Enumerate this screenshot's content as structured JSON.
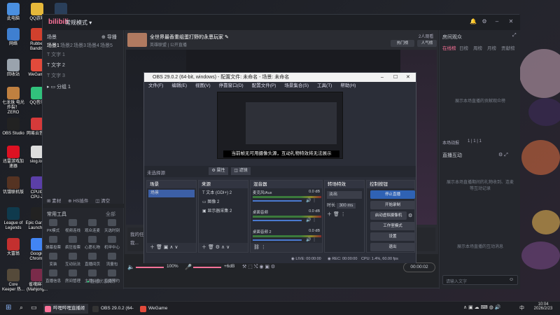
{
  "desktop": {
    "icons": [
      {
        "label": "此电脑",
        "color": "#4a8fe0"
      },
      {
        "label": "QQ游戏",
        "color": "#e6b83a"
      },
      {
        "label": "Steam",
        "color": "#2a3f5a"
      },
      {
        "label": "网络",
        "color": "#3f7fd0"
      },
      {
        "label": "Rubber Bandits",
        "color": "#d2402d"
      },
      {
        "label": "回收站",
        "color": "#9aa3ad"
      },
      {
        "label": "WeGame",
        "color": "#e24a3b"
      },
      {
        "label": "七龙珠 电光炸裂！ZERO",
        "color": "#c08040"
      },
      {
        "label": "QQ音乐",
        "color": "#31c27c"
      },
      {
        "label": "OBS Studio",
        "color": "#222"
      },
      {
        "label": "网易云音乐",
        "color": "#d63a3a"
      },
      {
        "label": "迅雷游戏加速器",
        "color": "#d12"
      },
      {
        "label": "slog.log",
        "color": "#ddd"
      },
      {
        "label": "饥饿联机版",
        "color": "#553322"
      },
      {
        "label": "CPUID CPU-Z",
        "color": "#5b3fa8"
      },
      {
        "label": "League of Legends",
        "color": "#0f3a4d"
      },
      {
        "label": "Epic Games Launcher",
        "color": "#222"
      },
      {
        "label": "大富翁",
        "color": "#c3302f"
      },
      {
        "label": "Google Chrome",
        "color": "#4285f4"
      },
      {
        "label": "Core Keeper 热...",
        "color": "#554a3a"
      },
      {
        "label": "雀魂麻将(Mahjong...",
        "color": "#7a2b4a"
      }
    ]
  },
  "livehime": {
    "logo": "bilibili",
    "mode": "常规模式",
    "scenes": {
      "title": "场景",
      "import": "导播",
      "tabs": [
        "场景1",
        "场景2",
        "场景3",
        "场景4",
        "场景5"
      ],
      "items": [
        "文字 1",
        "文字 2",
        "文字 3"
      ],
      "group": "分组 1",
      "bottom": [
        "素材",
        "HS插件",
        "清空"
      ]
    },
    "tools": {
      "title": "常用工具",
      "more": "全部",
      "items": [
        "PK模式",
        "视频连线",
        "观众连麦",
        "天选时刻",
        "弹幕投票",
        "疯狂投票",
        "心愿礼物",
        "机甲中心",
        "变装",
        "互动玩法",
        "直播间页",
        "流量包",
        "直播信息",
        "房间管理",
        "主播公告",
        "直播预约"
      ]
    },
    "stream": {
      "title": "全世界最香重组蛋打野的永恩玩家",
      "category": "英雄联盟",
      "visibility": "公开直播",
      "viewers": "2人观看",
      "btn_hot": "热门榜",
      "btn_rank": "人气榜"
    },
    "right": {
      "panel1_title": "房间观众",
      "tabs": [
        "在线榜",
        "日榜",
        "周榜",
        "月榜",
        "贡献榜"
      ],
      "empty1": "展示本场直播的贡献观众榜",
      "count_label": "本场战报",
      "counts": [
        "1",
        "1",
        "1"
      ],
      "panel2_title": "直播互动",
      "empty2": "展示本场直播期间的礼物收到、连麦等互动记录",
      "empty3": "展示本场直播的互动消息",
      "input_placeholder": "请输入文字",
      "send_icon": "emoji-icon"
    },
    "bottom": {
      "volume1": "100%",
      "volume2": "+6dB",
      "hint": "直播间提示",
      "timer": "00:00:02",
      "status": "直播状态良好",
      "notice_prefix": "我的任务",
      "notice_item": "我..."
    }
  },
  "obs": {
    "title": "OBS 29.0.2 (64-bit, windows) - 配置文件: 未命名 - 场景: 未命名",
    "menu": [
      "文件(F)",
      "编辑(E)",
      "视图(V)",
      "停靠窗口(D)",
      "配置文件(P)",
      "场景集合(S)",
      "工具(T)",
      "帮助(H)"
    ],
    "warning": "当前帧无可用摄像头源，互动礼物特效将无法展示",
    "no_source": "未选择源",
    "btn_props": "属性",
    "btn_filters": "滤镜",
    "docks": {
      "scenes": {
        "title": "场景",
        "items": [
          "场景"
        ]
      },
      "sources": {
        "title": "来源",
        "items": [
          "文本 (GDI+) 2",
          "图像 2",
          "显示器采集 2"
        ]
      },
      "mixer": {
        "title": "混音器",
        "channels": [
          {
            "name": "麦克风/Aux",
            "db": "0.0 dB"
          },
          {
            "name": "桌面音频",
            "db": "0.0 dB"
          },
          {
            "name": "桌面音频 2",
            "db": "0.0 dB"
          }
        ]
      },
      "transitions": {
        "title": "转场特效",
        "value": "淡出",
        "duration_label": "时长",
        "duration": "300 ms"
      },
      "controls": {
        "title": "控制按钮",
        "buttons": [
          "停止直播",
          "开始录制",
          "启动虚拟摄像机",
          "工作室模式",
          "设置",
          "退出"
        ]
      }
    },
    "status": {
      "live": "LIVE: 00:00:00",
      "rec": "REC: 00:00:00",
      "cpu": "CPU: 1.4%, 60.00 fps"
    }
  },
  "taskbar": {
    "apps": [
      {
        "label": "哔哩哔哩直播姬",
        "color": "#fb7299"
      },
      {
        "label": "OBS 29.0.2 (64-bi...",
        "color": "#333"
      },
      {
        "label": "WeGame",
        "color": "#e24a3b"
      }
    ],
    "time": "10:04",
    "date": "2026/2/23",
    "lang": "中"
  }
}
